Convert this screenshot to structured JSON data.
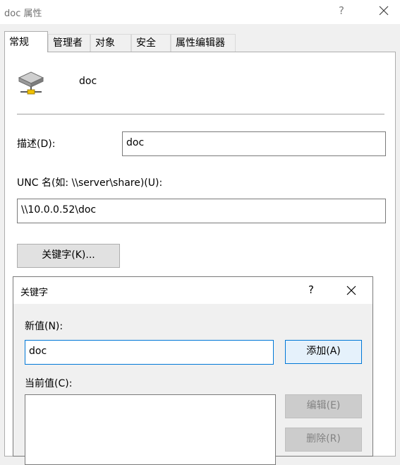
{
  "window": {
    "title": "doc 属性",
    "help": "?"
  },
  "tabs": [
    {
      "label": "常规",
      "active": true
    },
    {
      "label": "管理者",
      "active": false
    },
    {
      "label": "对象",
      "active": false
    },
    {
      "label": "安全",
      "active": false
    },
    {
      "label": "属性编辑器",
      "active": false
    }
  ],
  "general": {
    "share_name": "doc",
    "share_icon": "shared-folder-icon",
    "description_label": "描述(D):",
    "description_value": "doc",
    "unc_label": "UNC 名(如: \\\\server\\share)(U):",
    "unc_value": "\\\\10.0.0.52\\doc",
    "keywords_button": "关键字(K)..."
  },
  "keywords_dialog": {
    "title": "关键字",
    "help": "?",
    "new_value_label": "新值(N):",
    "new_value": "doc",
    "add_button": "添加(A)",
    "current_values_label": "当前值(C):",
    "current_values": [],
    "edit_button": "编辑(E)",
    "remove_button": "删除(R)",
    "edit_enabled": false,
    "remove_enabled": false
  },
  "colors": {
    "accent": "#0078d7",
    "window_bg": "#f0f0f0",
    "panel_bg": "#ffffff",
    "disabled_text": "#838383"
  }
}
